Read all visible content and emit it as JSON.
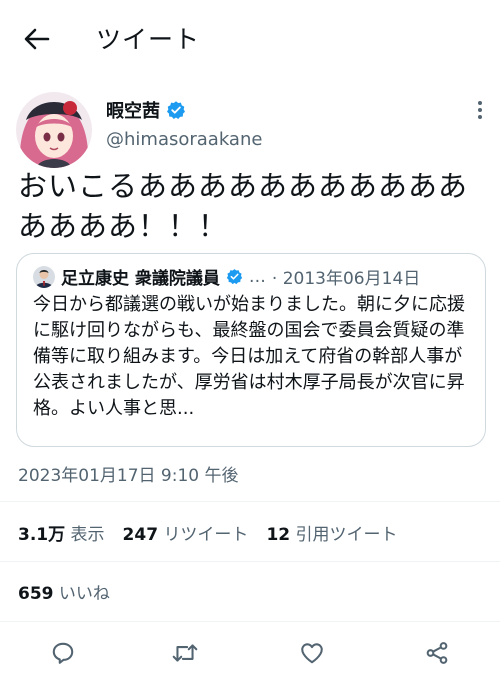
{
  "header": {
    "title": "ツイート",
    "back_icon": "arrow-left-icon"
  },
  "author": {
    "name": "暇空茜",
    "handle": "@himasoraakane",
    "verified": true,
    "verified_color": "#1d9bf0"
  },
  "tweet": {
    "text": "おいこるあああああああああああああああ！！！",
    "timestamp": "2023年01月17日 9:10 午後"
  },
  "quote": {
    "name": "足立康史 衆議院議員",
    "ellipsis": "…",
    "date": "· 2013年06月14日",
    "text": "今日から都議選の戦いが始まりました。朝に夕に応援に駆け回りながらも、最終盤の国会で委員会質疑の準備等に取り組みます。今日は加えて府省の幹部人事が公表されましたが、厚労省は村木厚子局長が次官に昇格。よい人事と思..."
  },
  "stats": {
    "views_value": "3.1万",
    "views_label": "表示",
    "retweets_value": "247",
    "retweets_label": "リツイート",
    "quotes_value": "12",
    "quotes_label": "引用ツイート",
    "likes_value": "659",
    "likes_label": "いいね"
  },
  "actions": [
    "reply-icon",
    "retweet-icon",
    "like-icon",
    "share-icon"
  ],
  "colors": {
    "text": "#0f1419",
    "muted": "#536471",
    "accent": "#1d9bf0",
    "border": "#cfd9de"
  }
}
